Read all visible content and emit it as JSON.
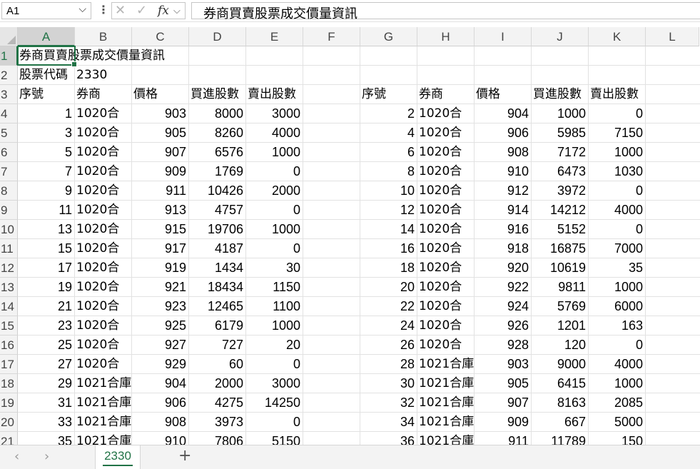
{
  "formula_bar": {
    "name_box": "A1",
    "formula": "券商買賣股票成交價量資訊",
    "fx": "fx"
  },
  "columns": [
    "A",
    "B",
    "C",
    "D",
    "E",
    "F",
    "G",
    "H",
    "I",
    "J",
    "K",
    "L"
  ],
  "rows": [
    "1",
    "2",
    "3",
    "4",
    "5",
    "6",
    "7",
    "8",
    "9",
    "10",
    "11",
    "12",
    "13",
    "14",
    "15",
    "16",
    "17",
    "18",
    "19",
    "20",
    "21"
  ],
  "cells": {
    "A1": "券商買賣股票成交價量資訊",
    "A2": "股票代碼",
    "B2": "2330",
    "headers_left": [
      "序號",
      "券商",
      "價格",
      "買進股數",
      "賣出股數"
    ],
    "headers_right": [
      "序號",
      "券商",
      "價格",
      "買進股數",
      "賣出股數"
    ]
  },
  "left_table": [
    [
      "1",
      "1020合",
      "903",
      "8000",
      "3000"
    ],
    [
      "3",
      "1020合",
      "905",
      "8260",
      "4000"
    ],
    [
      "5",
      "1020合",
      "907",
      "6576",
      "1000"
    ],
    [
      "7",
      "1020合",
      "909",
      "1769",
      "0"
    ],
    [
      "9",
      "1020合",
      "911",
      "10426",
      "2000"
    ],
    [
      "11",
      "1020合",
      "913",
      "4757",
      "0"
    ],
    [
      "13",
      "1020合",
      "915",
      "19706",
      "1000"
    ],
    [
      "15",
      "1020合",
      "917",
      "4187",
      "0"
    ],
    [
      "17",
      "1020合",
      "919",
      "1434",
      "30"
    ],
    [
      "19",
      "1020合",
      "921",
      "18434",
      "1150"
    ],
    [
      "21",
      "1020合",
      "923",
      "12465",
      "1100"
    ],
    [
      "23",
      "1020合",
      "925",
      "6179",
      "1000"
    ],
    [
      "25",
      "1020合",
      "927",
      "727",
      "20"
    ],
    [
      "27",
      "1020合",
      "929",
      "60",
      "0"
    ],
    [
      "29",
      "1021合庫",
      "904",
      "2000",
      "3000"
    ],
    [
      "31",
      "1021合庫",
      "906",
      "4275",
      "14250"
    ],
    [
      "33",
      "1021合庫",
      "908",
      "3973",
      "0"
    ],
    [
      "35",
      "1021合庫",
      "910",
      "7806",
      "5150"
    ]
  ],
  "right_table": [
    [
      "2",
      "1020合",
      "904",
      "1000",
      "0"
    ],
    [
      "4",
      "1020合",
      "906",
      "5985",
      "7150"
    ],
    [
      "6",
      "1020合",
      "908",
      "7172",
      "1000"
    ],
    [
      "8",
      "1020合",
      "910",
      "6473",
      "1030"
    ],
    [
      "10",
      "1020合",
      "912",
      "3972",
      "0"
    ],
    [
      "12",
      "1020合",
      "914",
      "14212",
      "4000"
    ],
    [
      "14",
      "1020合",
      "916",
      "5152",
      "0"
    ],
    [
      "16",
      "1020合",
      "918",
      "16875",
      "7000"
    ],
    [
      "18",
      "1020合",
      "920",
      "10619",
      "35"
    ],
    [
      "20",
      "1020合",
      "922",
      "9811",
      "1000"
    ],
    [
      "22",
      "1020合",
      "924",
      "5769",
      "6000"
    ],
    [
      "24",
      "1020合",
      "926",
      "1201",
      "163"
    ],
    [
      "26",
      "1020合",
      "928",
      "120",
      "0"
    ],
    [
      "28",
      "1021合庫",
      "903",
      "9000",
      "4000"
    ],
    [
      "30",
      "1021合庫",
      "905",
      "6415",
      "1000"
    ],
    [
      "32",
      "1021合庫",
      "907",
      "8163",
      "2085"
    ],
    [
      "34",
      "1021合庫",
      "909",
      "667",
      "5000"
    ],
    [
      "36",
      "1021合庫",
      "911",
      "11789",
      "150"
    ]
  ],
  "sheet_tabs": {
    "active": "2330",
    "prev": "‹",
    "next": "›",
    "add": "+"
  }
}
